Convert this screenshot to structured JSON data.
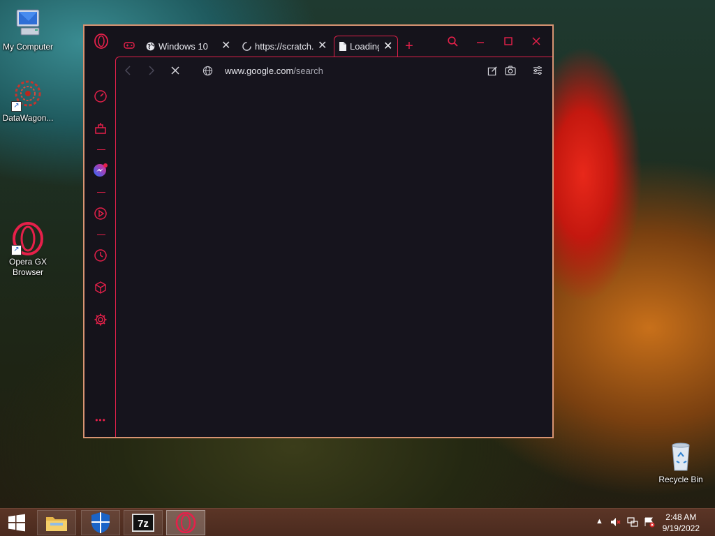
{
  "desktop": {
    "icons": [
      {
        "label": "My Computer"
      },
      {
        "label": "DataWagon..."
      },
      {
        "label": "Opera GX Browser"
      },
      {
        "label": "Recycle Bin"
      }
    ]
  },
  "browser": {
    "tabs": [
      {
        "label": "Windows 10"
      },
      {
        "label": "https://scratch.m"
      },
      {
        "label": "Loading"
      }
    ],
    "address": {
      "host": "www.google.com",
      "path": "/search"
    },
    "accent": "#e6204a",
    "window_border": "#d89472"
  },
  "taskbar": {
    "time": "2:48 AM",
    "date": "9/19/2022",
    "color": "#4f2d20"
  }
}
